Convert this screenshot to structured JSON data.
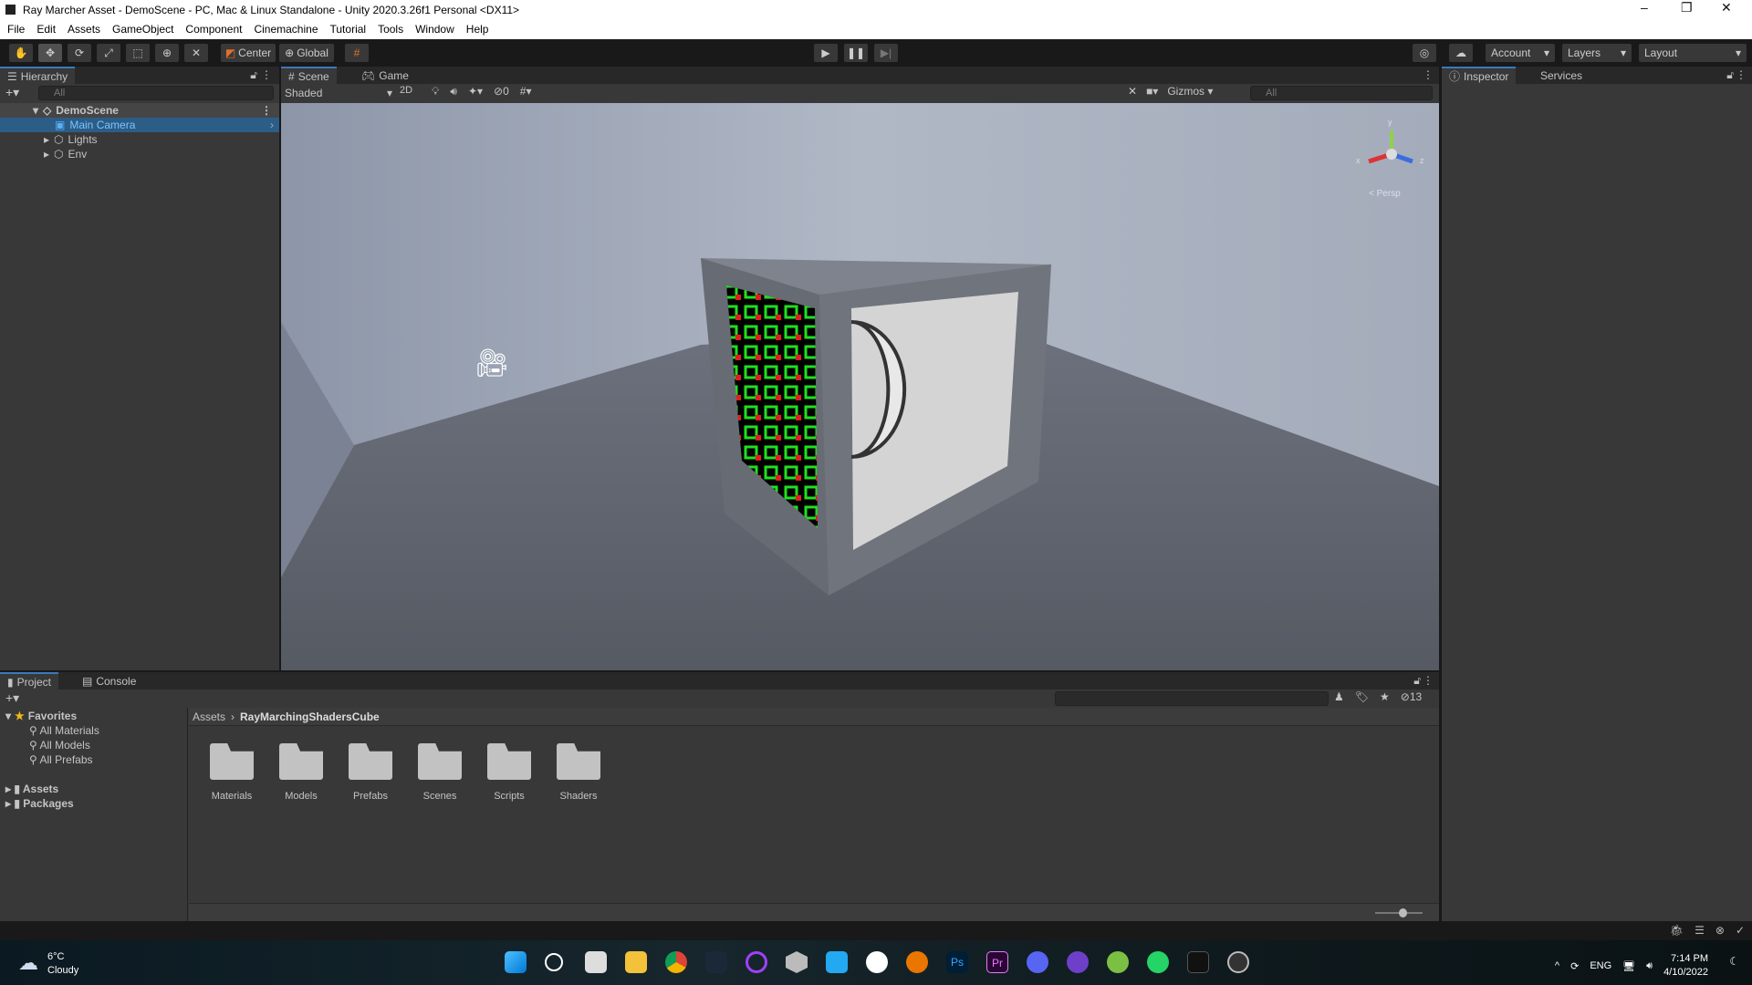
{
  "window": {
    "title": "Ray Marcher Asset - DemoScene - PC, Mac & Linux Standalone - Unity 2020.3.26f1 Personal <DX11>",
    "minimize": "–",
    "maximize": "❐",
    "close": "✕"
  },
  "menu": [
    "File",
    "Edit",
    "Assets",
    "GameObject",
    "Component",
    "Cinemachine",
    "Tutorial",
    "Tools",
    "Window",
    "Help"
  ],
  "toolbar": {
    "tools": [
      "hand-tool",
      "move-tool",
      "rotate-tool",
      "scale-tool",
      "rect-tool",
      "transform-tool",
      "custom-tool"
    ],
    "active_tool": "move-tool",
    "pivot": "Center",
    "space": "Global",
    "account": "Account",
    "layers": "Layers",
    "layout": "Layout"
  },
  "hierarchy": {
    "tab": "Hierarchy",
    "search_placeholder": "All",
    "scene": "DemoScene",
    "items": [
      {
        "label": "Main Camera",
        "selected_color": "#4aa8ff"
      },
      {
        "label": "Lights"
      },
      {
        "label": "Env"
      }
    ]
  },
  "scene_view": {
    "tabs": [
      "Scene",
      "Game"
    ],
    "active_tab": "Scene",
    "shading": "Shaded",
    "mode_2d": "2D",
    "hidden_count": "0",
    "gizmos": "Gizmos",
    "search_placeholder": "All",
    "persp_label": "< Persp",
    "axes": {
      "x": "x",
      "y": "y",
      "z": "z"
    }
  },
  "inspector": {
    "tabs": [
      "Inspector",
      "Services"
    ]
  },
  "project": {
    "tabs": [
      "Project",
      "Console"
    ],
    "favorites": {
      "label": "Favorites",
      "items": [
        "All Materials",
        "All Models",
        "All Prefabs"
      ]
    },
    "roots": [
      "Assets",
      "Packages"
    ],
    "breadcrumb": [
      "Assets",
      "RayMarchingShadersCube"
    ],
    "folders": [
      "Materials",
      "Models",
      "Prefabs",
      "Scenes",
      "Scripts",
      "Shaders"
    ],
    "hidden_count": "13"
  },
  "taskbar": {
    "weather_temp": "6°C",
    "weather_desc": "Cloudy",
    "lang": "ENG",
    "time": "7:14 PM",
    "date": "4/10/2022"
  },
  "colors": {
    "accent": "#3a79bb",
    "selection": "#2c5d87"
  }
}
